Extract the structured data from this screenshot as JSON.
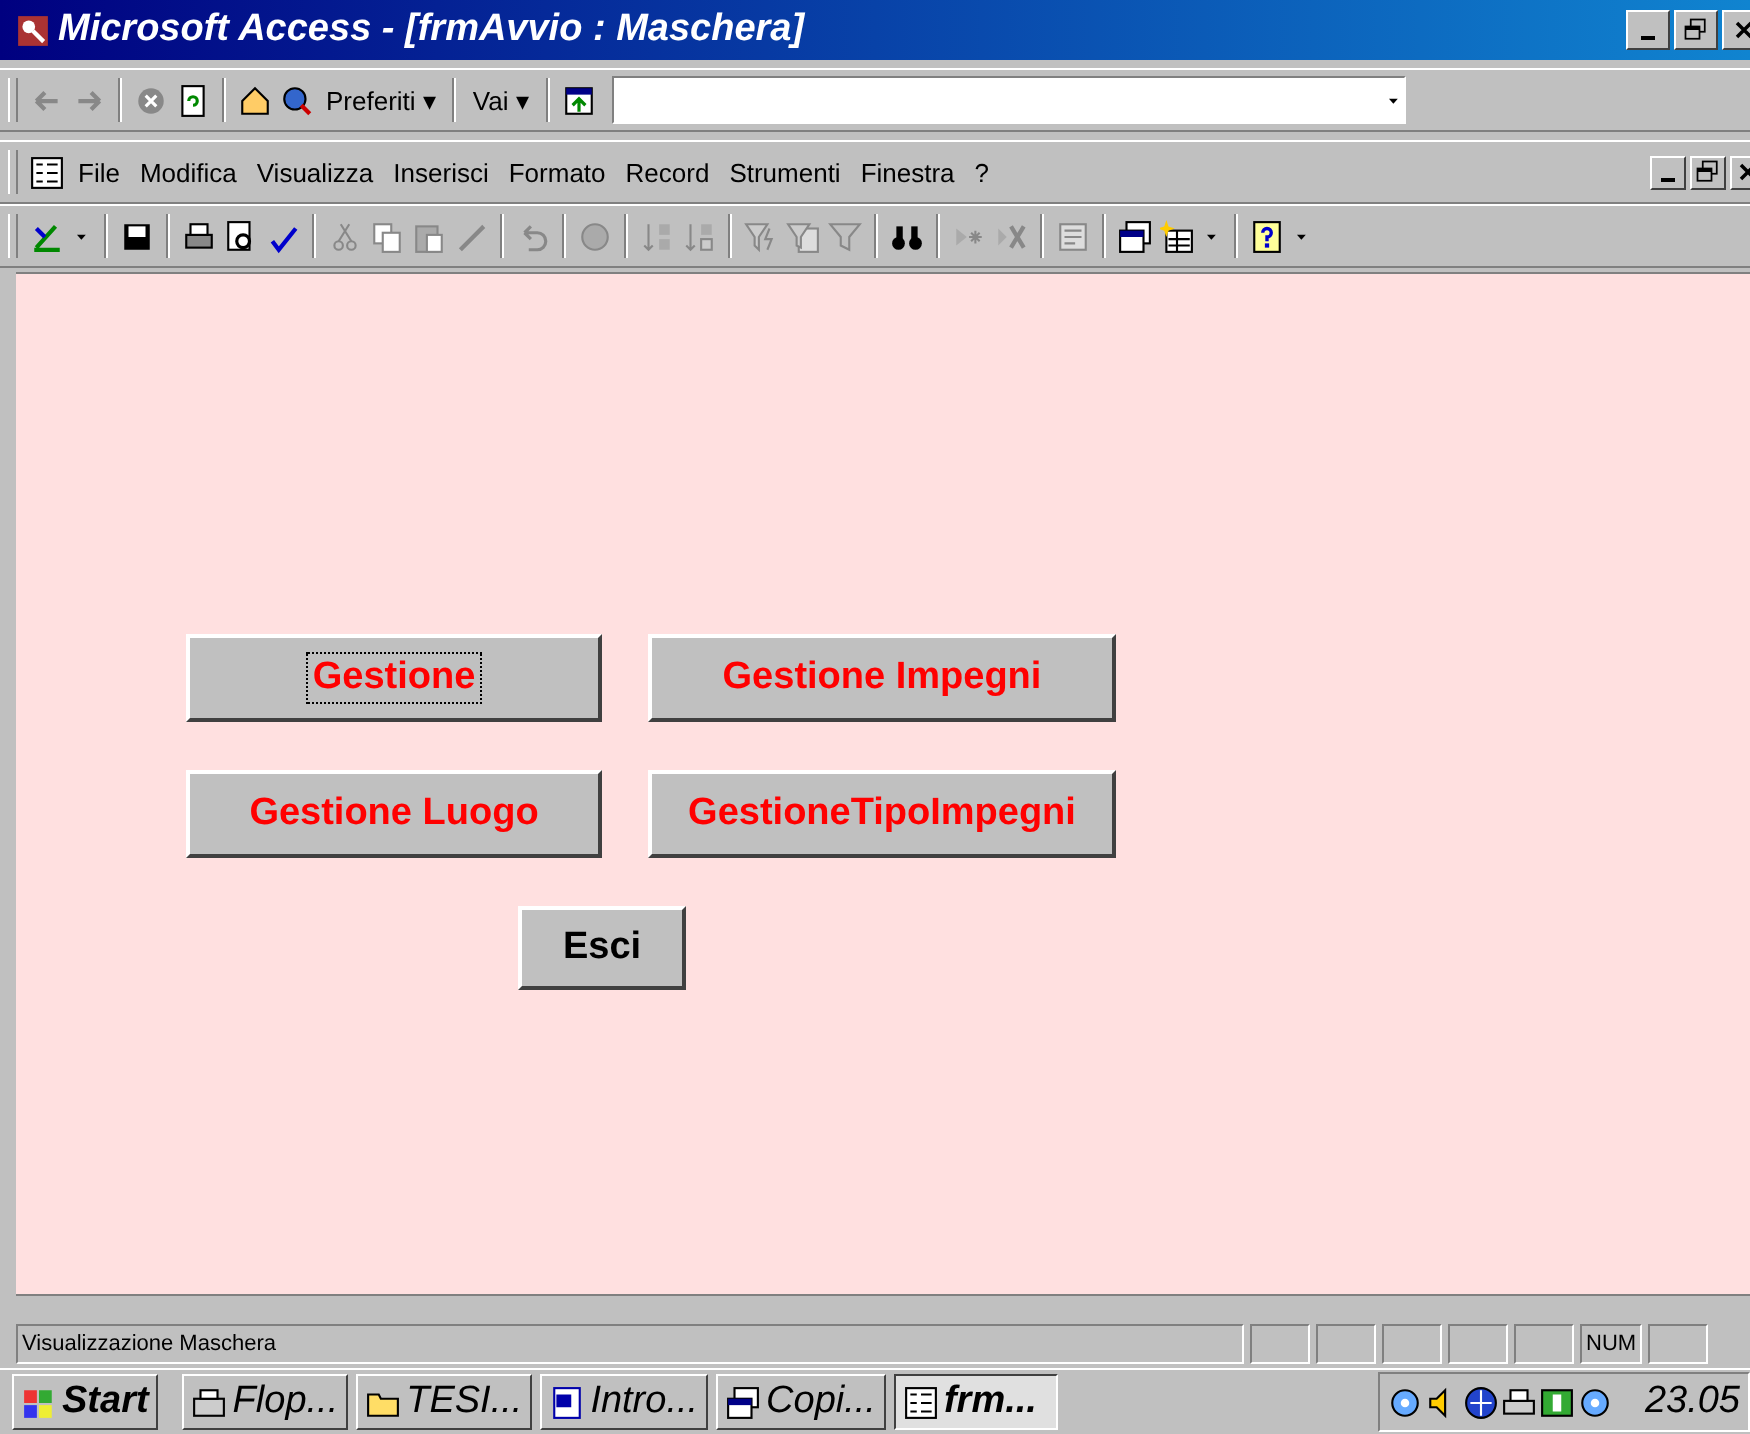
{
  "window": {
    "title": "Microsoft Access - [frmAvvio : Maschera]"
  },
  "web_toolbar": {
    "favorites": "Preferiti ▾",
    "go": "Vai ▾"
  },
  "menu": [
    "File",
    "Modifica",
    "Visualizza",
    "Inserisci",
    "Formato",
    "Record",
    "Strumenti",
    "Finestra",
    "?"
  ],
  "form": {
    "buttons": [
      {
        "label": "Gestione",
        "color": "#ff0000",
        "focused": true
      },
      {
        "label": "Gestione Impegni",
        "color": "#ff0000",
        "focused": false
      },
      {
        "label": "Gestione Luogo",
        "color": "#ff0000",
        "focused": false
      },
      {
        "label": "GestioneTipoImpegni",
        "color": "#ff0000",
        "focused": false
      },
      {
        "label": "Esci",
        "color": "#000000",
        "focused": false
      }
    ]
  },
  "status_bar": {
    "text": "Visualizzazione Maschera",
    "indicators": [
      {
        "kind": "blank"
      },
      {
        "kind": "blank"
      },
      {
        "kind": "blank"
      },
      {
        "kind": "blank"
      },
      {
        "kind": "blank"
      },
      {
        "kind": "text",
        "text": "NUM"
      },
      {
        "kind": "blank"
      }
    ]
  },
  "taskbar": {
    "start": "Start",
    "items": [
      {
        "label": "Flop...",
        "selected": false
      },
      {
        "label": "TESI...",
        "selected": false
      },
      {
        "label": "Intro...",
        "selected": false
      },
      {
        "label": "Copi...",
        "selected": false
      },
      {
        "label": "frm...",
        "selected": true
      }
    ],
    "clock": "23.05"
  }
}
